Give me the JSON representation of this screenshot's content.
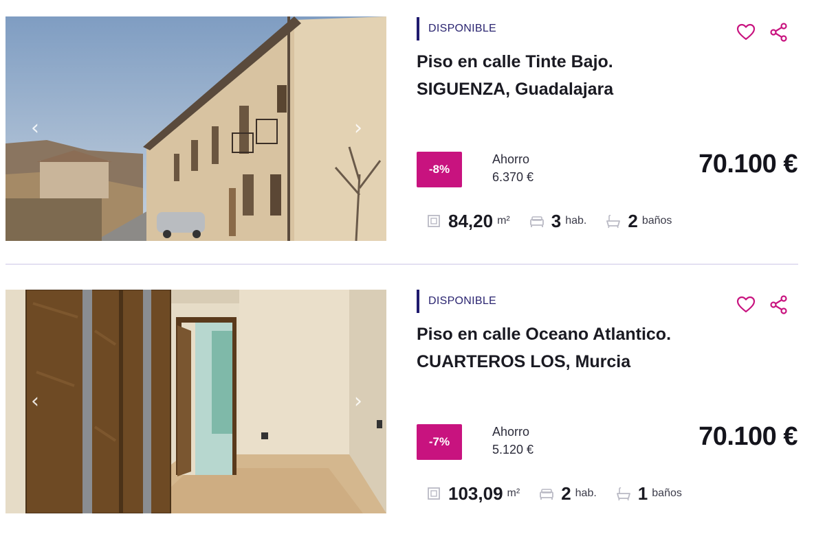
{
  "listings": [
    {
      "status": "DISPONIBLE",
      "title_line1": "Piso en calle Tinte Bajo.",
      "title_line2": "SIGUENZA, Guadalajara",
      "discount": "-8%",
      "savings_label": "Ahorro",
      "savings_amount": "6.370 €",
      "price": "70.100 €",
      "area_value": "84,20",
      "area_unit": "m²",
      "rooms_value": "3",
      "rooms_unit": "hab.",
      "baths_value": "2",
      "baths_unit": "baños",
      "photo_icon": "building-exterior-photo"
    },
    {
      "status": "DISPONIBLE",
      "title_line1": "Piso en calle Oceano Atlantico.",
      "title_line2": "CUARTEROS LOS, Murcia",
      "discount": "-7%",
      "savings_label": "Ahorro",
      "savings_amount": "5.120 €",
      "price": "70.100 €",
      "area_value": "103,09",
      "area_unit": "m²",
      "rooms_value": "2",
      "rooms_unit": "hab.",
      "baths_value": "1",
      "baths_unit": "baños",
      "photo_icon": "interior-hallway-photo"
    }
  ],
  "icons": {
    "favorite": "heart-icon",
    "share": "share-icon",
    "prev": "chevron-left-icon",
    "next": "chevron-right-icon",
    "area": "area-icon",
    "rooms": "bed-icon",
    "baths": "bathtub-icon"
  },
  "colors": {
    "accent": "#c8137f",
    "status_bar": "#1f1a6e",
    "divider": "#e3e0f2"
  }
}
